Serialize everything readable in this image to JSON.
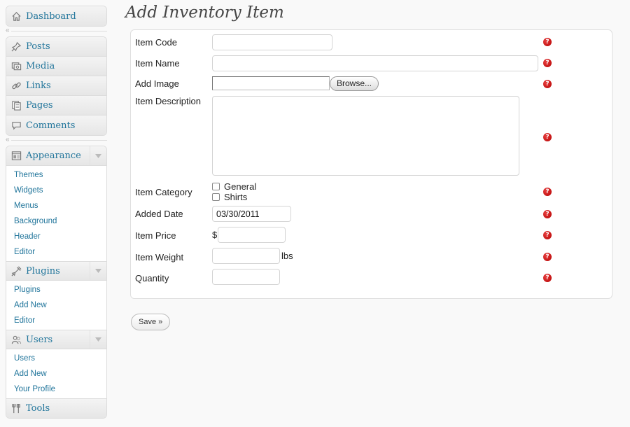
{
  "sidebar": {
    "dashboard": "Dashboard",
    "group1": [
      {
        "label": "Posts",
        "icon": "pushpin-icon"
      },
      {
        "label": "Media",
        "icon": "media-icon"
      },
      {
        "label": "Links",
        "icon": "link-icon"
      },
      {
        "label": "Pages",
        "icon": "pages-icon"
      },
      {
        "label": "Comments",
        "icon": "comment-icon"
      }
    ],
    "appearance": {
      "label": "Appearance",
      "items": [
        "Themes",
        "Widgets",
        "Menus",
        "Background",
        "Header",
        "Editor"
      ]
    },
    "plugins": {
      "label": "Plugins",
      "items": [
        "Plugins",
        "Add New",
        "Editor"
      ]
    },
    "users": {
      "label": "Users",
      "items": [
        "Users",
        "Add New",
        "Your Profile"
      ]
    },
    "tools": "Tools"
  },
  "page": {
    "title": "Add Inventory Item"
  },
  "form": {
    "item_code": {
      "label": "Item Code",
      "value": ""
    },
    "item_name": {
      "label": "Item Name",
      "value": ""
    },
    "add_image": {
      "label": "Add Image",
      "button": "Browse..."
    },
    "item_description": {
      "label": "Item Description",
      "value": ""
    },
    "item_category": {
      "label": "Item Category",
      "options": [
        "General",
        "Shirts"
      ]
    },
    "added_date": {
      "label": "Added Date",
      "value": "03/30/2011"
    },
    "item_price": {
      "label": "Item Price",
      "prefix": "$",
      "value": ""
    },
    "item_weight": {
      "label": "Item Weight",
      "unit": "lbs",
      "value": ""
    },
    "quantity": {
      "label": "Quantity",
      "value": ""
    },
    "help_symbol": "?"
  },
  "actions": {
    "save": "Save »"
  },
  "colors": {
    "link": "#21759b",
    "help_icon": "#c00000"
  }
}
